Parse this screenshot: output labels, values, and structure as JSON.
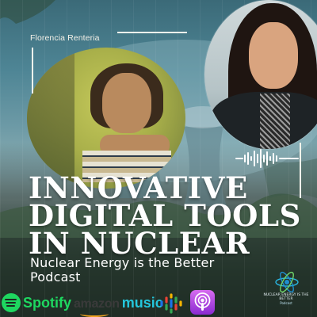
{
  "cover": {
    "guest_name": "Florencia Renteria",
    "headline_lines": [
      "INNOVATIVE",
      "DIGITAL TOOLS",
      "IN NUCLEAR"
    ],
    "subtitle_lines": [
      "Nuclear Energy is the Better",
      "Podcast"
    ]
  },
  "platforms": {
    "spotify": "Spotify",
    "amazon_prefix": "amazon",
    "amazon_suffix": "music"
  },
  "brand_logo": {
    "line1": "NUCLEAR ENERGY IS THE BETTER",
    "line2": "Podcast"
  },
  "icons": {
    "waveform": "audio-waveform-icon",
    "spotify": "spotify-logo-icon",
    "google_podcasts": "google-podcasts-icon",
    "apple_podcasts": "apple-podcasts-icon",
    "atom": "atom-logo-icon"
  },
  "colors": {
    "spotify_green": "#1ed760",
    "amazon_music_cyan": "#24c6dc",
    "apple_podcasts_purple": "#8a2ad1",
    "headline_white": "#ffffff"
  }
}
